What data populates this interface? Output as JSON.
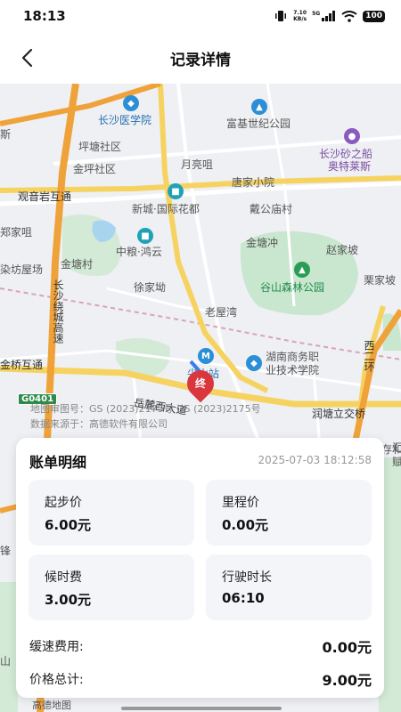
{
  "status_bar": {
    "time": "18:13",
    "net_speed_value": "7.10",
    "net_speed_unit": "KB/s",
    "signal_type": "5G",
    "battery": "100"
  },
  "header": {
    "title": "记录详情"
  },
  "map": {
    "labels": {
      "changsha_medical": "长沙医学院",
      "fuji_park": "富基世纪公园",
      "pingtang_community": "坪塘社区",
      "jinping_community": "金坪社区",
      "yueliang_ju": "月亮咀",
      "changsha_outlets_1": "长沙砂之船",
      "changsha_outlets_2": "奥特莱斯",
      "guanyinyan": "观音岩互通",
      "tangjia": "唐家小院",
      "xincheng_flowers": "新城·国际花都",
      "daigong": "戴公庙村",
      "zhengjia": "郑家咀",
      "zhongliang": "中粮·鸿云",
      "jintang_chong": "金塘冲",
      "zhaojia": "赵家坡",
      "ranfang": "染坊屋场",
      "jintang_village": "金塘村",
      "xujia": "徐家坳",
      "gushan_forest": "谷山森林公园",
      "lijia": "栗家坡",
      "ring_expressway": "长沙绕城高速",
      "laowuwan": "老屋湾",
      "hunan_business_1": "湖南商务职",
      "hunan_business_2": "业技术学院",
      "second_ring": "西二环",
      "jinqiao": "金桥互通",
      "station": "尖山站",
      "yuelu_avenue": "岳麓西大道",
      "runtang": "润塘立交桥",
      "road_g0401": "G0401",
      "amap_logo": "高德地图",
      "copyright_1": "地图审图号：GS (2023)2175号 GS (2023)2175号",
      "copyright_2": "数据来源于：高德软件有限公司",
      "edge_lishi": "汇",
      "edge_si": "斯",
      "edge_cunhe": "存和",
      "edge_fu": "赋",
      "edge_fengxi": "锋",
      "edge_shan": "山"
    },
    "end_marker": "终"
  },
  "bill": {
    "title": "账单明细",
    "date": "2025-07-03 18:12:58",
    "fees": [
      {
        "label": "起步价",
        "value": "6.00元"
      },
      {
        "label": "里程价",
        "value": "0.00元"
      },
      {
        "label": "候时费",
        "value": "3.00元"
      },
      {
        "label": "行驶时长",
        "value": "06:10"
      }
    ],
    "slow_fee_label": "缓速费用:",
    "slow_fee_value": "0.00元",
    "total_label": "价格总计:",
    "total_value": "9.00元"
  }
}
